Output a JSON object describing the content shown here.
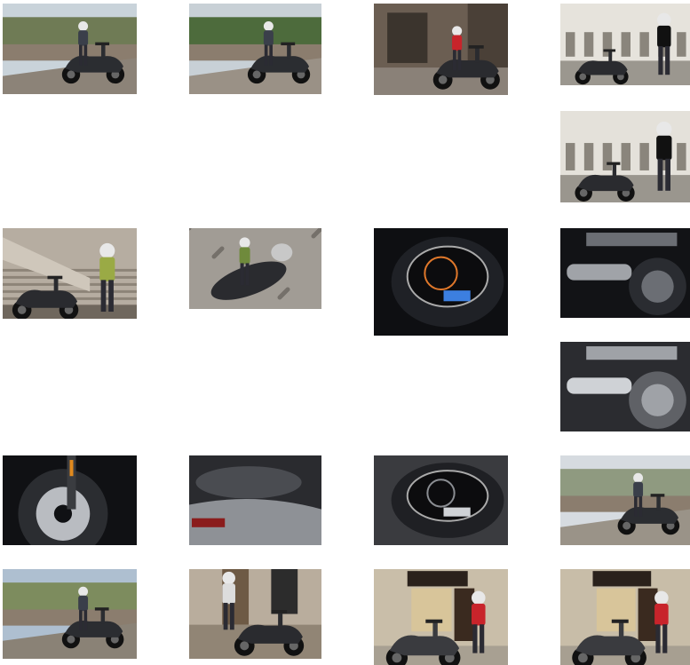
{
  "gallery": {
    "items": [
      {
        "id": 1,
        "scene": "road",
        "palette": [
          "#c9d3da",
          "#6f7b55",
          "#8c8378",
          "#2b2d31"
        ]
      },
      {
        "id": 2,
        "scene": "road",
        "palette": [
          "#c8d0d6",
          "#4d6b3c",
          "#9a9186",
          "#2b2d31"
        ]
      },
      {
        "id": 3,
        "scene": "street",
        "palette": [
          "#6b5e52",
          "#3b342d",
          "#8a8178",
          "#2a2b2f"
        ]
      },
      {
        "id": 4,
        "scene": "plaza",
        "palette": [
          "#e6e3dc",
          "#c9c2b6",
          "#9b978f",
          "#2a2b2f"
        ]
      },
      {
        "id": 5,
        "scene": "plaza",
        "palette": [
          "#e4e1da",
          "#c7c0b4",
          "#9a968e",
          "#2a2b2f"
        ]
      },
      {
        "id": 6,
        "scene": "stairs",
        "palette": [
          "#b6ada1",
          "#8d8478",
          "#6f675d",
          "#2a2b2f"
        ]
      },
      {
        "id": 7,
        "scene": "topdown",
        "palette": [
          "#8e8982",
          "#a19c95",
          "#75706a",
          "#2a2b2f"
        ]
      },
      {
        "id": 8,
        "scene": "dash",
        "palette": [
          "#0e0f12",
          "#1f2126",
          "#e0782b",
          "#3c7fe0"
        ]
      },
      {
        "id": 9,
        "scene": "detail",
        "palette": [
          "#121316",
          "#2a2c31",
          "#6b6e74",
          "#a0a3a8"
        ]
      },
      {
        "id": 10,
        "scene": "detail",
        "palette": [
          "#2b2c30",
          "#5f6166",
          "#9fa2a7",
          "#cfd2d6"
        ]
      },
      {
        "id": 11,
        "scene": "wheel",
        "palette": [
          "#101114",
          "#2b2d31",
          "#b9bcc1",
          "#e08a1e"
        ]
      },
      {
        "id": 12,
        "scene": "seat",
        "palette": [
          "#2a2b2f",
          "#4a4c51",
          "#8e9196",
          "#c7cacf"
        ]
      },
      {
        "id": 13,
        "scene": "dash",
        "palette": [
          "#3a3b3f",
          "#1f2024",
          "#8a8d92",
          "#cfd2d6"
        ]
      },
      {
        "id": 14,
        "scene": "road",
        "palette": [
          "#d6dbe0",
          "#8f9a80",
          "#9a9388",
          "#2b2d31"
        ]
      },
      {
        "id": 15,
        "scene": "road",
        "palette": [
          "#aebfd0",
          "#7d8c5e",
          "#8a8276",
          "#2b2d31"
        ]
      },
      {
        "id": 16,
        "scene": "doorway",
        "palette": [
          "#b9ad9d",
          "#6e5a45",
          "#918575",
          "#2a2b2f"
        ]
      },
      {
        "id": 17,
        "scene": "shop",
        "palette": [
          "#c9bea9",
          "#2a211b",
          "#a8a092",
          "#3a3b3f"
        ]
      },
      {
        "id": 18,
        "scene": "shop",
        "palette": [
          "#c8bda8",
          "#2a211b",
          "#a79f91",
          "#3a3b3f"
        ]
      }
    ]
  }
}
